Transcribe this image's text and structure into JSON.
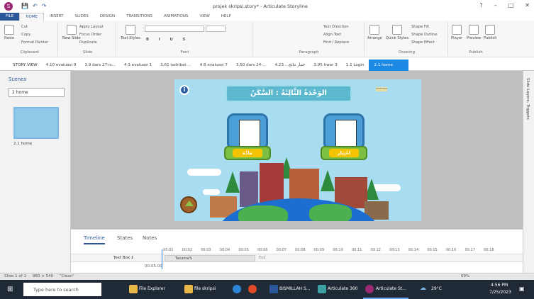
{
  "window": {
    "title": "projek skripsi.story* - Articulate Storyline",
    "app_icon": "S"
  },
  "ribbon_tabs": [
    "FILE",
    "HOME",
    "INSERT",
    "SLIDES",
    "DESIGN",
    "TRANSITIONS",
    "ANIMATIONS",
    "VIEW",
    "HELP"
  ],
  "ribbon": {
    "clipboard": {
      "paste": "Paste",
      "cut": "Cut",
      "copy": "Copy",
      "format_painter": "Format Painter",
      "label": "Clipboard"
    },
    "slide": {
      "new_slide": "New Slide",
      "apply_layout": "Apply Layout",
      "focus_order": "Focus Order",
      "duplicate": "Duplicate",
      "label": "Slide"
    },
    "font": {
      "text_styles": "Text Styles",
      "label": "Font"
    },
    "paragraph": {
      "text_direction": "Text Direction",
      "align_text": "Align Text",
      "find_replace": "Find / Replace",
      "label": "Paragraph"
    },
    "drawing": {
      "arrange": "Arrange",
      "quick_styles": "Quick Styles",
      "shape_fill": "Shape Fill",
      "shape_outline": "Shape Outline",
      "shape_effect": "Shape Effect",
      "label": "Drawing"
    },
    "publish": {
      "player": "Player",
      "preview": "Preview",
      "publish": "Publish",
      "label": "Publish"
    }
  },
  "slide_tabs": {
    "story_view": "STORY VIEW",
    "tabs": [
      "4.10 evaluasi 9",
      "3.9 dars 27-is...",
      "4.3 evaluasi 1",
      "3.61 tadribat ...",
      "4.8 evaluasi 7",
      "3.50 dars 24-...",
      "4.23 ...ختبار نتائج",
      "3.95 hwar 3",
      "1.1 Login"
    ],
    "active": "2.1 home"
  },
  "scenes": {
    "header": "Scenes",
    "selected": "2 home",
    "thumb_label": "2.1 home"
  },
  "right_panel": {
    "label": "Slide Layers, Triggers"
  },
  "slide": {
    "title": "الوَحْدَةُ الثَّالِثَةُ : السَّكَنُ",
    "logo_text": "STARTTALK",
    "card_left_label": "مَادَّة",
    "card_right_label": "اخْتِبَار"
  },
  "timeline": {
    "tabs": [
      "Timeline",
      "States",
      "Notes"
    ],
    "active_tab": "Timeline",
    "ticks": [
      "00:01",
      "00:02",
      "00:03",
      "00:04",
      "00:05",
      "00:06",
      "00:07",
      "00:08",
      "00:09",
      "00:10",
      "00:11",
      "00:12",
      "00:13",
      "00:14",
      "00:15",
      "00:16",
      "00:17",
      "00:18"
    ],
    "row_label": "Text Box 1",
    "row_bar": "Tanama%",
    "row_end": "End",
    "time_display": "00:05.00"
  },
  "status": {
    "slide": "Slide 1 of 1",
    "size": "960 × 540",
    "theme": "\"Clean\"",
    "zoom": "69%"
  },
  "taskbar": {
    "search_placeholder": "Type here to search",
    "items": [
      "File Explorer",
      "file skripsi",
      "BISMILLAH S...",
      "Articulate 360",
      "Articulate St..."
    ],
    "weather": "29°C",
    "time": "4:56 PM",
    "date": "7/25/2023"
  }
}
